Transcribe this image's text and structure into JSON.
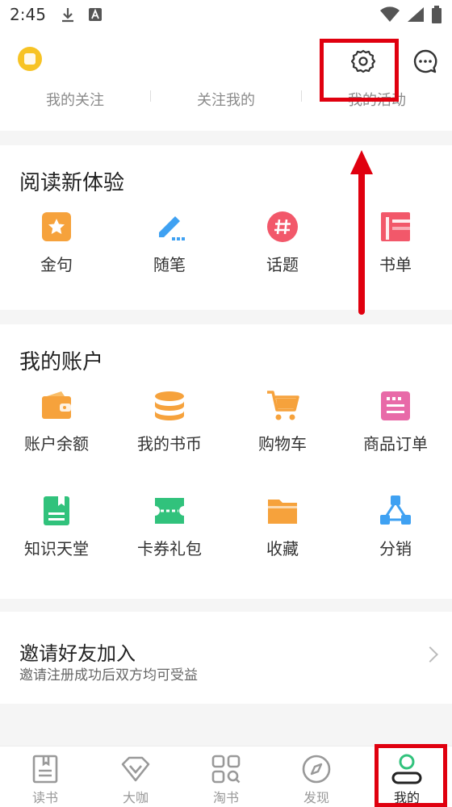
{
  "status_bar": {
    "time": "2:45"
  },
  "top": {
    "follow_items": [
      "我的关注",
      "关注我的",
      "我的活动"
    ]
  },
  "reading": {
    "title": "阅读新体验",
    "items": [
      {
        "label": "金句",
        "icon": "star-bookmark-icon",
        "color": "#f6a23c"
      },
      {
        "label": "随笔",
        "icon": "pencil-icon",
        "color": "#3fa1f2"
      },
      {
        "label": "话题",
        "icon": "hashtag-icon",
        "color": "#f2586a"
      },
      {
        "label": "书单",
        "icon": "booklist-icon",
        "color": "#f2586a"
      }
    ]
  },
  "account": {
    "title": "我的账户",
    "items": [
      {
        "label": "账户余额",
        "icon": "wallet-icon",
        "color": "#f6a23c"
      },
      {
        "label": "我的书币",
        "icon": "coins-icon",
        "color": "#f6a23c"
      },
      {
        "label": "购物车",
        "icon": "cart-icon",
        "color": "#f6a23c"
      },
      {
        "label": "商品订单",
        "icon": "order-icon",
        "color": "#e86aa8"
      },
      {
        "label": "知识天堂",
        "icon": "knowledge-book-icon",
        "color": "#31c27c"
      },
      {
        "label": "卡券礼包",
        "icon": "ticket-icon",
        "color": "#31c27c"
      },
      {
        "label": "收藏",
        "icon": "folder-icon",
        "color": "#f6a23c"
      },
      {
        "label": "分销",
        "icon": "share-network-icon",
        "color": "#3fa1f2"
      }
    ]
  },
  "invite": {
    "title": "邀请好友加入",
    "subtitle": "邀请注册成功后双方均可受益"
  },
  "tabs": [
    {
      "label": "读书",
      "icon": "book-icon"
    },
    {
      "label": "大咖",
      "icon": "diamond-icon"
    },
    {
      "label": "淘书",
      "icon": "grid-search-icon"
    },
    {
      "label": "发现",
      "icon": "compass-icon"
    },
    {
      "label": "我的",
      "icon": "profile-icon",
      "active": true
    }
  ]
}
